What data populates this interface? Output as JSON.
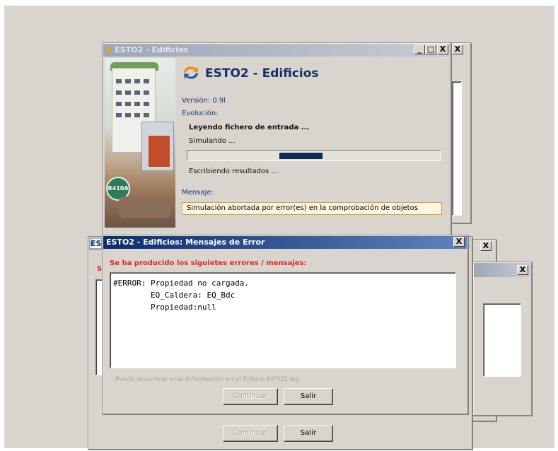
{
  "app_window": {
    "title": "ESTO2 - Edificios",
    "heading": "ESTO2 - Edificios",
    "version_label": "Versión:",
    "version_value": "0.9l",
    "evolution_label": "Evolución:",
    "stages": [
      "Leyendo fichero de entrada ...",
      "Simulando ...",
      "Escribiendo resultados ..."
    ],
    "progress_fraction": 0.17,
    "message_label": "Mensaje:",
    "message_text": "Simulación abortada por error(es) en la comprobación de objetos",
    "art_badge_text": "R410A"
  },
  "error_dialog": {
    "title": "ESTO2 - Edificios: Mensajes de Error",
    "heading": "Se ha producido los siguietes errores / mensajes:",
    "error_lines": [
      "#ERROR: Propiedad no cargada.",
      "        EQ_Caldera: EQ_Bdc",
      "        Propiedad:null"
    ],
    "info_text": "Puede encontrar más información en el fichero ESTO2.log",
    "continue_label": "Continuar",
    "exit_label": "Salir"
  },
  "back_dialog": {
    "title_fragment": "ES",
    "heading_fragment": "S",
    "continue_label": "Continuar",
    "exit_label": "Salir"
  },
  "titlebar_buttons": {
    "minimize": "_",
    "maximize": "□",
    "close": "X"
  },
  "colors": {
    "titlebar_active": "#0b2c6e",
    "heading_blue": "#13306b",
    "error_red": "#e2231a",
    "progress_fill": "#0c2a5a",
    "message_border": "#d7a04a"
  }
}
